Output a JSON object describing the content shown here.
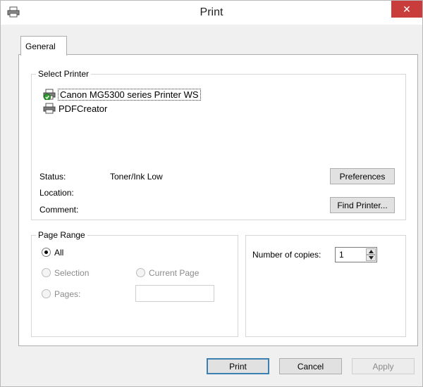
{
  "window": {
    "title": "Print",
    "close_glyph": "✕"
  },
  "tabs": [
    {
      "label": "General"
    }
  ],
  "select_printer": {
    "legend": "Select Printer",
    "printers": [
      {
        "name": "Canon MG5300 series Printer WS",
        "icon": "printer-default-icon",
        "selected": true
      },
      {
        "name": "PDFCreator",
        "icon": "printer-icon",
        "selected": false
      }
    ],
    "status_label": "Status:",
    "status_value": "Toner/Ink Low",
    "location_label": "Location:",
    "location_value": "",
    "comment_label": "Comment:",
    "comment_value": "",
    "preferences_button": "Preferences",
    "find_printer_button": "Find Printer..."
  },
  "page_range": {
    "legend": "Page Range",
    "all_label": "All",
    "selection_label": "Selection",
    "current_page_label": "Current Page",
    "pages_label": "Pages:",
    "pages_value": "",
    "selected": "All"
  },
  "copies": {
    "label": "Number of copies:",
    "value": "1"
  },
  "footer": {
    "print_button": "Print",
    "cancel_button": "Cancel",
    "apply_button": "Apply"
  }
}
